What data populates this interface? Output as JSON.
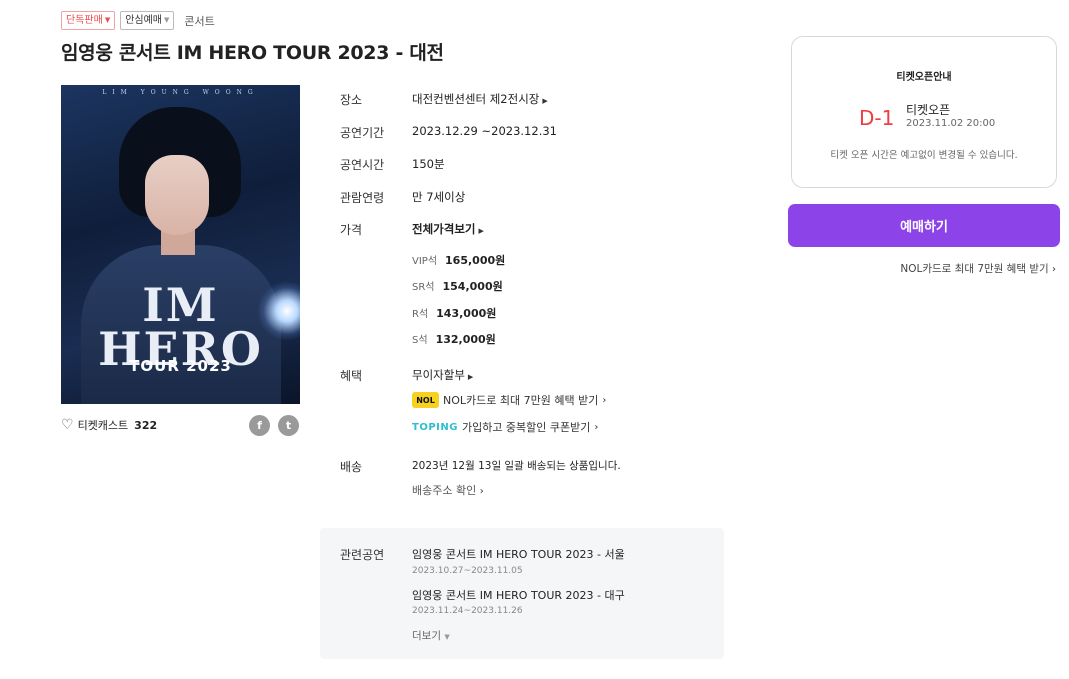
{
  "tags": {
    "exclusive": "단독판매",
    "safe": "안심예매",
    "category": "콘서트"
  },
  "title": "임영웅 콘서트 IM HERO TOUR 2023 - 대전",
  "poster": {
    "top_text": "LIM YOUNG WOONG",
    "logo_line1": "IM",
    "logo_line2": "HERO",
    "tour": "TOUR 2023"
  },
  "likes": {
    "label": "티켓캐스트",
    "count": "322"
  },
  "share": {
    "facebook": "f",
    "twitter": "t"
  },
  "info": {
    "venue_label": "장소",
    "venue": "대전컨벤션센터 제2전시장",
    "period_label": "공연기간",
    "period": "2023.12.29 ~2023.12.31",
    "runtime_label": "공연시간",
    "runtime": "150분",
    "age_label": "관람연령",
    "age": "만 7세이상",
    "price_label": "가격",
    "price_all": "전체가격보기",
    "prices": [
      {
        "grade": "VIP석",
        "amount": "165,000원"
      },
      {
        "grade": "SR석",
        "amount": "154,000원"
      },
      {
        "grade": "R석",
        "amount": "143,000원"
      },
      {
        "grade": "S석",
        "amount": "132,000원"
      }
    ],
    "benefit_label": "혜택",
    "benefit_main": "무이자할부",
    "benefit_nol": "NOL카드로 최대 7만원 혜택 받기",
    "nol_logo": "NOL",
    "benefit_toping": "가입하고 중복할인 쿠폰받기",
    "toping_logo": "TOPING",
    "delivery_label": "배송",
    "delivery_text": "2023년 12월 13일 일괄 배송되는 상품입니다.",
    "delivery_address": "배송주소 확인"
  },
  "related": {
    "label": "관련공연",
    "items": [
      {
        "title": "임영웅 콘서트 IM HERO TOUR 2023 - 서울",
        "date": "2023.10.27~2023.11.05"
      },
      {
        "title": "임영웅 콘서트 IM HERO TOUR 2023 - 대구",
        "date": "2023.11.24~2023.11.26"
      }
    ],
    "more": "더보기"
  },
  "ticket_open": {
    "title": "티켓오픈안내",
    "dday": "D-1",
    "label": "티켓오픈",
    "date": "2023.11.02 20:00",
    "note": "티켓 오픈 시간은 예고없이 변경될 수 있습니다."
  },
  "booking": {
    "button": "예매하기",
    "nol_benefit": "NOL카드로 최대 7만원 혜택 받기"
  },
  "colors": {
    "accent": "#8c44e8",
    "dday": "#ef3e42",
    "tag_red": "#ee4b4b"
  }
}
